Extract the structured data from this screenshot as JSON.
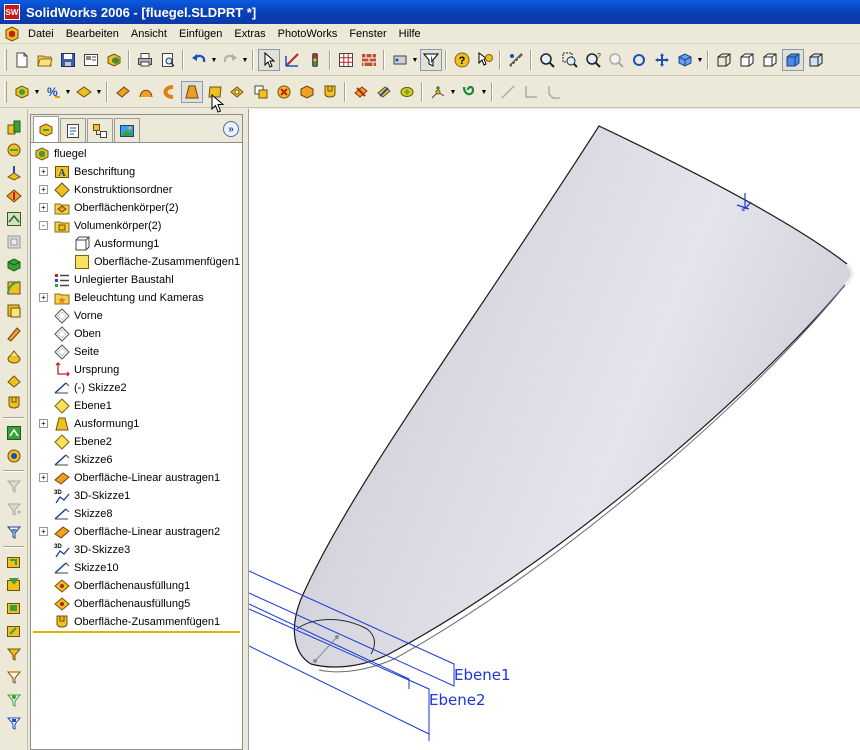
{
  "window": {
    "title": "SolidWorks 2006 - [fluegel.SLDPRT *]",
    "app_icon_label": "SW"
  },
  "menu": [
    "Datei",
    "Bearbeiten",
    "Ansicht",
    "Einfügen",
    "Extras",
    "PhotoWorks",
    "Fenster",
    "Hilfe"
  ],
  "feature_tree": {
    "root": "fluegel",
    "items": [
      {
        "label": "Beschriftung",
        "icon": "annotation-icon",
        "expander": "+"
      },
      {
        "label": "Konstruktionsordner",
        "icon": "design-binder-icon",
        "expander": "+"
      },
      {
        "label": "Oberflächenkörper(2)",
        "icon": "surface-bodies-folder-icon",
        "expander": "+"
      },
      {
        "label": "Volumenkörper(2)",
        "icon": "solid-bodies-folder-icon",
        "expander": "-"
      },
      {
        "label": "Ausformung1",
        "icon": "solid-body-icon",
        "expander": ""
      },
      {
        "label": "Oberfläche-Zusammenfügen1",
        "icon": "solid-body-selected-icon",
        "expander": ""
      },
      {
        "label": "Unlegierter Baustahl",
        "icon": "material-icon",
        "expander": ""
      },
      {
        "label": "Beleuchtung und Kameras",
        "icon": "lights-cameras-icon",
        "expander": "+"
      },
      {
        "label": "Vorne",
        "icon": "plane-icon",
        "expander": ""
      },
      {
        "label": "Oben",
        "icon": "plane-icon",
        "expander": ""
      },
      {
        "label": "Seite",
        "icon": "plane-icon",
        "expander": ""
      },
      {
        "label": "Ursprung",
        "icon": "origin-icon",
        "expander": ""
      },
      {
        "label": "(-) Skizze2",
        "icon": "sketch-icon",
        "expander": ""
      },
      {
        "label": "Ebene1",
        "icon": "ref-plane-icon",
        "expander": ""
      },
      {
        "label": "Ausformung1",
        "icon": "loft-icon",
        "expander": "+"
      },
      {
        "label": "Ebene2",
        "icon": "ref-plane-icon",
        "expander": ""
      },
      {
        "label": "Skizze6",
        "icon": "sketch-icon",
        "expander": ""
      },
      {
        "label": "Oberfläche-Linear austragen1",
        "icon": "surface-extrude-icon",
        "expander": "+"
      },
      {
        "label": "3D-Skizze1",
        "icon": "3d-sketch-icon",
        "expander": ""
      },
      {
        "label": "Skizze8",
        "icon": "sketch-icon",
        "expander": ""
      },
      {
        "label": "Oberfläche-Linear austragen2",
        "icon": "surface-extrude-icon",
        "expander": "+"
      },
      {
        "label": "3D-Skizze3",
        "icon": "3d-sketch-icon",
        "expander": ""
      },
      {
        "label": "Skizze10",
        "icon": "sketch-icon",
        "expander": ""
      },
      {
        "label": "Oberflächenausfüllung1",
        "icon": "surface-fill-icon",
        "expander": ""
      },
      {
        "label": "Oberflächenausfüllung5",
        "icon": "surface-fill-icon",
        "expander": ""
      },
      {
        "label": "Oberfläche-Zusammenfügen1",
        "icon": "surface-knit-icon",
        "expander": ""
      }
    ]
  },
  "viewport": {
    "plane_labels": [
      "Ebene1",
      "Ebene2"
    ]
  },
  "colors": {
    "titlebar": "#0a46c8",
    "plane_lines": "#1a36d8",
    "tree_end_bar": "#e0b400"
  }
}
